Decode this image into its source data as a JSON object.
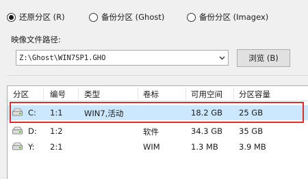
{
  "restore_options": [
    {
      "label": "还原分区 (R)",
      "selected": true
    },
    {
      "label": "备份分区 (Ghost)",
      "selected": false
    },
    {
      "label": "备份分区 (Imagex)",
      "selected": false
    }
  ],
  "image_path": {
    "label": "映像文件路径:",
    "value": "Z:\\Ghost\\WIN7SP1.GHO",
    "browse_label": "浏览 (B)"
  },
  "table": {
    "columns": [
      "分区",
      "编号",
      "类型",
      "卷标",
      "可用空间",
      "分区容量"
    ],
    "rows": [
      {
        "partition": "C:",
        "number": "1:1",
        "type": "WIN7,活动",
        "volume_label": "",
        "free_space": "18.2 GB",
        "capacity": "25 GB",
        "selected": true
      },
      {
        "partition": "D:",
        "number": "1:2",
        "type": "",
        "volume_label": "软件",
        "free_space": "34.3 GB",
        "capacity": "35 GB",
        "selected": false
      },
      {
        "partition": "Y:",
        "number": "2:1",
        "type": "",
        "volume_label": "WIM",
        "free_space": "1.3 MB",
        "capacity": "3.9 MB",
        "selected": false
      }
    ]
  },
  "colors": {
    "selection_background": "#cce8ff",
    "selection_frame": "#d9302f"
  },
  "icons": {
    "drive": "hard-drive-icon",
    "dropdown": "chevron-down-icon"
  }
}
